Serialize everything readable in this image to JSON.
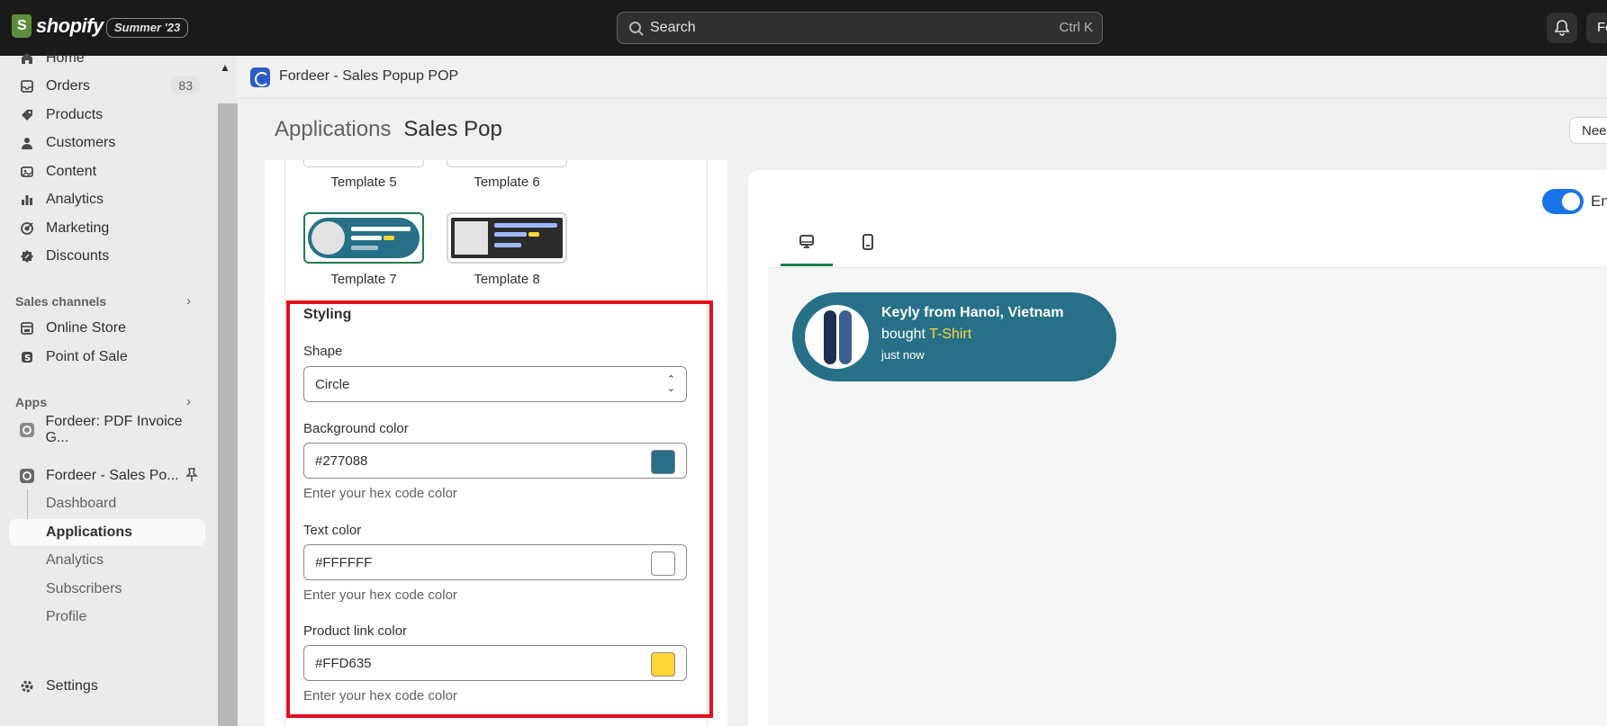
{
  "topbar": {
    "logo_text": "shopify",
    "edition": "Summer '23",
    "search_placeholder": "Search",
    "search_shortcut": "Ctrl K",
    "avatar_initial": "Fo"
  },
  "sidebar": {
    "items": [
      {
        "label": "Home"
      },
      {
        "label": "Orders",
        "count": "83"
      },
      {
        "label": "Products"
      },
      {
        "label": "Customers"
      },
      {
        "label": "Content"
      },
      {
        "label": "Analytics"
      },
      {
        "label": "Marketing"
      },
      {
        "label": "Discounts"
      }
    ],
    "sales_channels_heading": "Sales channels",
    "sales_channels": [
      {
        "label": "Online Store"
      },
      {
        "label": "Point of Sale"
      }
    ],
    "apps_heading": "Apps",
    "apps": [
      {
        "label": "Fordeer: PDF Invoice G..."
      },
      {
        "label": "Fordeer - Sales Po..."
      }
    ],
    "app_subitems": [
      {
        "label": "Dashboard"
      },
      {
        "label": "Applications"
      },
      {
        "label": "Analytics"
      },
      {
        "label": "Subscribers"
      },
      {
        "label": "Profile"
      }
    ],
    "settings_label": "Settings"
  },
  "app_header": {
    "title": "Fordeer - Sales Popup POP"
  },
  "breadcrumb": {
    "parent": "Applications",
    "current": "Sales Pop"
  },
  "need_help_label": "Need",
  "templates": [
    {
      "label": "Template 5"
    },
    {
      "label": "Template 6"
    },
    {
      "label": "Template 7",
      "selected": true
    },
    {
      "label": "Template 8"
    }
  ],
  "styling": {
    "title": "Styling",
    "shape_label": "Shape",
    "shape_value": "Circle",
    "background_label": "Background color",
    "background_value": "#277088",
    "text_color_label": "Text color",
    "text_color_value": "#FFFFFF",
    "link_color_label": "Product link color",
    "link_color_value": "#FFD635",
    "help_text": "Enter your hex code color"
  },
  "preview": {
    "toggle_label": "En",
    "toggle_on": true,
    "popup_name": "Keyly from Hanoi, Vietnam",
    "popup_action": "bought",
    "popup_product": "T-Shirt",
    "popup_time": "just now"
  },
  "colors": {
    "popup_bg": "#277088",
    "popup_text": "#FFFFFF",
    "popup_link": "#FFD635",
    "accent_green": "#1f7a52",
    "highlight_red": "#e0101c"
  },
  "icons": [
    "search-icon",
    "bell-icon",
    "home-icon",
    "orders-icon",
    "products-icon",
    "customers-icon",
    "content-icon",
    "analytics-icon",
    "marketing-icon",
    "discounts-icon",
    "online-store-icon",
    "pos-icon",
    "app-icon",
    "pin-icon",
    "settings-icon",
    "desktop-icon",
    "mobile-icon",
    "chevron-right-icon",
    "select-arrows-icon"
  ]
}
